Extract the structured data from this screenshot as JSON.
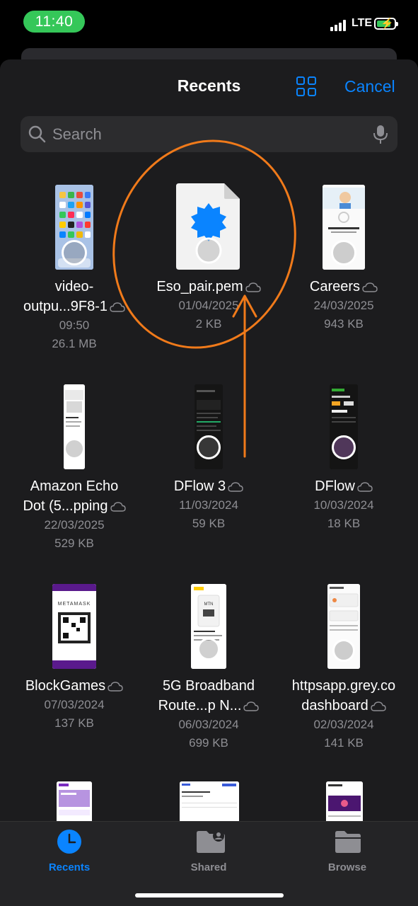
{
  "status": {
    "time": "11:40",
    "network": "LTE"
  },
  "header": {
    "title": "Recents",
    "cancel_label": "Cancel",
    "grid_icon": "grid-icon"
  },
  "search": {
    "placeholder": "Search"
  },
  "files": [
    {
      "name1": "video-",
      "name2": "outpu...9F8-1",
      "date": "09:50",
      "size": "26.1 MB",
      "cloud": true
    },
    {
      "name1": "Eso_pair.pem",
      "name2": "",
      "date": "01/04/2025",
      "size": "2 KB",
      "cloud": true
    },
    {
      "name1": "Careers",
      "name2": "",
      "date": "24/03/2025",
      "size": "943 KB",
      "cloud": true
    },
    {
      "name1": "Amazon Echo",
      "name2": "Dot (5...pping",
      "date": "22/03/2025",
      "size": "529 KB",
      "cloud": true
    },
    {
      "name1": "DFlow 3",
      "name2": "",
      "date": "11/03/2024",
      "size": "59 KB",
      "cloud": true
    },
    {
      "name1": "DFlow",
      "name2": "",
      "date": "10/03/2024",
      "size": "18 KB",
      "cloud": true
    },
    {
      "name1": "BlockGames",
      "name2": "",
      "date": "07/03/2024",
      "size": "137 KB",
      "cloud": true
    },
    {
      "name1": "5G Broadband",
      "name2": "Route...p N...",
      "date": "06/03/2024",
      "size": "699 KB",
      "cloud": true
    },
    {
      "name1": "httpsapp.grey.co",
      "name2": "dashboard",
      "date": "02/03/2024",
      "size": "141 KB",
      "cloud": true
    }
  ],
  "thumb_text": {
    "metamask": "METAMASK",
    "mtn": "MTN"
  },
  "tabs": [
    {
      "label": "Recents",
      "icon": "clock-icon",
      "active": true
    },
    {
      "label": "Shared",
      "icon": "shared-folder-icon",
      "active": false
    },
    {
      "label": "Browse",
      "icon": "folder-icon",
      "active": false
    }
  ],
  "colors": {
    "accent": "#0a84ff",
    "annotation": "#f07a1a",
    "battery": "#35c759"
  }
}
